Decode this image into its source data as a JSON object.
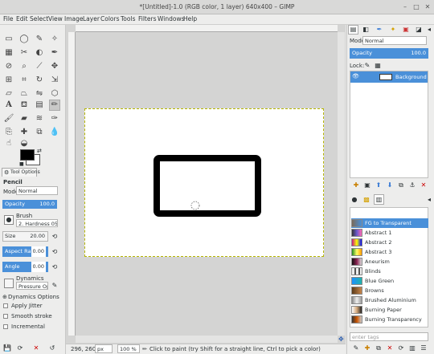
{
  "window": {
    "title": "*[Untitled]-1.0 (RGB color, 1 layer) 640x400 – GIMP"
  },
  "menu": [
    "File",
    "Edit",
    "Select",
    "View",
    "Image",
    "Layer",
    "Colors",
    "Tools",
    "Filters",
    "Windows",
    "Help"
  ],
  "tool_options": {
    "tab_label": "Tool Options",
    "tool_name": "Pencil",
    "mode_label": "Mode",
    "mode_value": "Normal",
    "opacity_label": "Opacity",
    "opacity_value": "100.0",
    "brush_label": "Brush",
    "brush_value": "2. Hardness 05",
    "size_label": "Size",
    "size_value": "20.00",
    "aspect_label": "Aspect Ratio",
    "aspect_value": "0.00",
    "angle_label": "Angle",
    "angle_value": "0.00",
    "dynamics_label": "Dynamics",
    "dynamics_value": "Pressure Opacity",
    "dynamics_options": "Dynamics Options",
    "apply_jitter": "Apply Jitter",
    "smooth_stroke": "Smooth stroke",
    "incremental": "Incremental"
  },
  "status": {
    "coords": "296, 260",
    "unit": "px",
    "zoom": "100 %",
    "message": "Click to paint (try Shift for a straight line, Ctrl to pick a color)"
  },
  "layers": {
    "mode_label": "Mode",
    "mode_value": "Normal",
    "opacity_label": "Opacity",
    "opacity_value": "100.0",
    "lock_label": "Lock:",
    "layer_name": "Background"
  },
  "gradients": {
    "filter_placeholder": "enter tags",
    "items": [
      {
        "name": "FG to Transparent",
        "color": "#7a6a5a"
      },
      {
        "name": "Abstract 1",
        "color": "#6a5acd"
      },
      {
        "name": "Abstract 2",
        "color": "#c71585"
      },
      {
        "name": "Abstract 3",
        "color": "#228b22"
      },
      {
        "name": "Aneurism",
        "color": "#8b2252"
      },
      {
        "name": "Blinds",
        "color": "#777777"
      },
      {
        "name": "Blue Green",
        "color": "#20b2aa"
      },
      {
        "name": "Browns",
        "color": "#8b5a2b"
      },
      {
        "name": "Brushed Aluminium",
        "color": "#b0b0b0"
      },
      {
        "name": "Burning Paper",
        "color": "#d2a679"
      },
      {
        "name": "Burning Transparency",
        "color": "#cc5500"
      }
    ]
  },
  "colors": {
    "accent": "#4a90d9",
    "fg": "#000000",
    "bg": "#ffffff"
  }
}
